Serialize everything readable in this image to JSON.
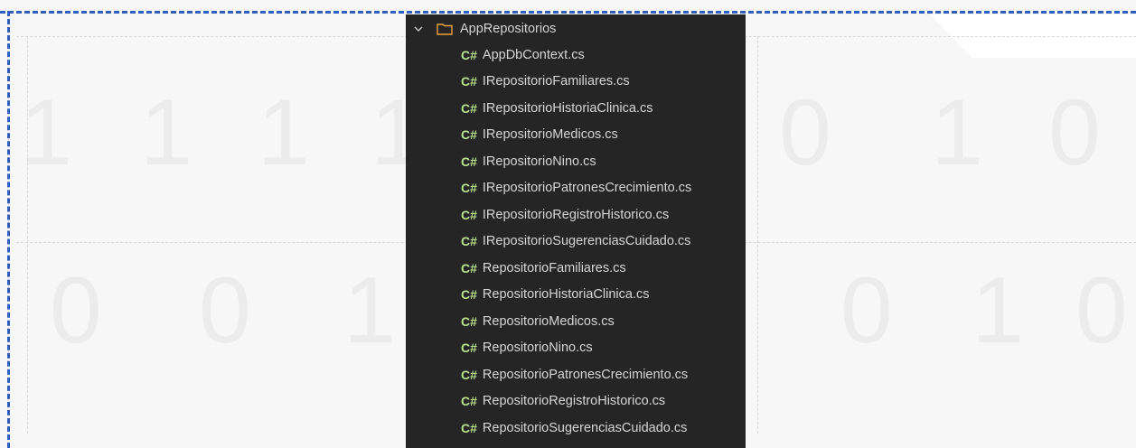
{
  "explorer": {
    "folder": {
      "name": "AppRepositorios",
      "expanded": true,
      "icon": "folder-icon"
    },
    "file_badge": "C#",
    "files": [
      "AppDbContext.cs",
      "IRepositorioFamiliares.cs",
      "IRepositorioHistoriaClinica.cs",
      "IRepositorioMedicos.cs",
      "IRepositorioNino.cs",
      "IRepositorioPatronesCrecimiento.cs",
      "IRepositorioRegistroHistorico.cs",
      "IRepositorioSugerenciasCuidado.cs",
      "RepositorioFamiliares.cs",
      "RepositorioHistoriaClinica.cs",
      "RepositorioMedicos.cs",
      "RepositorioNino.cs",
      "RepositorioPatronesCrecimiento.cs",
      "RepositorioRegistroHistorico.cs",
      "RepositorioSugerenciasCuidado.cs"
    ]
  },
  "background": {
    "digits": [
      "1",
      "1",
      "1",
      "1",
      "0",
      "1",
      "0",
      "0",
      "0",
      "1",
      "0",
      "1",
      "0"
    ]
  },
  "colors": {
    "panel_bg": "#252526",
    "badge": "#b9e38f",
    "text": "#d6d6d6",
    "folder_stroke": "#e8a33a",
    "dashed_border": "#2f5fc0"
  }
}
